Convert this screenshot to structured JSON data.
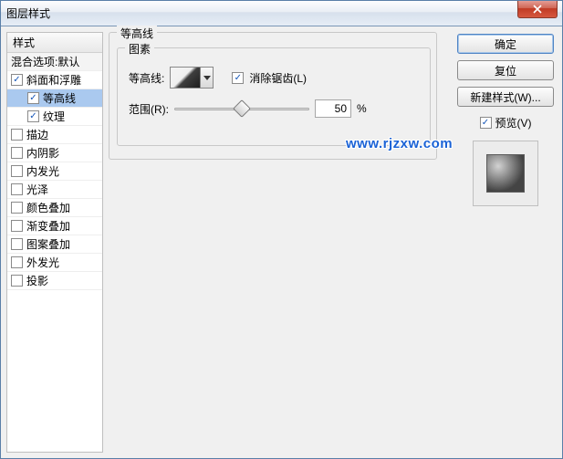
{
  "window": {
    "title": "图层样式"
  },
  "styles": {
    "header": "样式",
    "blendOptions": "混合选项:默认",
    "items": [
      {
        "label": "斜面和浮雕",
        "checked": true,
        "selected": false,
        "child": false
      },
      {
        "label": "等高线",
        "checked": true,
        "selected": true,
        "child": true
      },
      {
        "label": "纹理",
        "checked": true,
        "selected": false,
        "child": true
      },
      {
        "label": "描边",
        "checked": false,
        "selected": false,
        "child": false
      },
      {
        "label": "内阴影",
        "checked": false,
        "selected": false,
        "child": false
      },
      {
        "label": "内发光",
        "checked": false,
        "selected": false,
        "child": false
      },
      {
        "label": "光泽",
        "checked": false,
        "selected": false,
        "child": false
      },
      {
        "label": "颜色叠加",
        "checked": false,
        "selected": false,
        "child": false
      },
      {
        "label": "渐变叠加",
        "checked": false,
        "selected": false,
        "child": false
      },
      {
        "label": "图案叠加",
        "checked": false,
        "selected": false,
        "child": false
      },
      {
        "label": "外发光",
        "checked": false,
        "selected": false,
        "child": false
      },
      {
        "label": "投影",
        "checked": false,
        "selected": false,
        "child": false
      }
    ]
  },
  "panel": {
    "group1": "等高线",
    "group2": "图素",
    "contourLabel": "等高线:",
    "antialias": {
      "label": "消除锯齿(L)",
      "checked": true
    },
    "rangeLabel": "范围(R):",
    "rangeValue": "50",
    "rangeUnit": "%"
  },
  "buttons": {
    "ok": "确定",
    "cancel": "复位",
    "newStyle": "新建样式(W)...",
    "preview": {
      "label": "预览(V)",
      "checked": true
    }
  },
  "watermark": "www.rjzxw.com"
}
